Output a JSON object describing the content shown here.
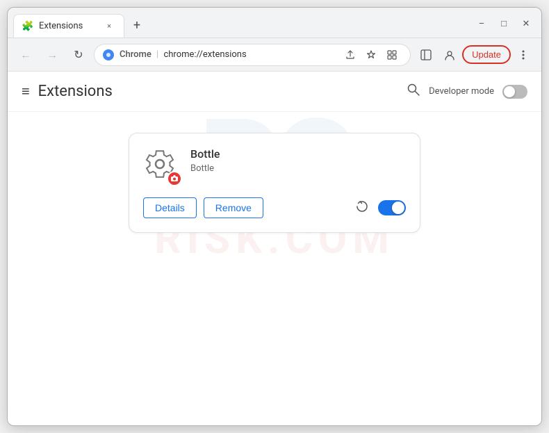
{
  "browser": {
    "tab": {
      "favicon": "🧩",
      "title": "Extensions",
      "close_label": "×"
    },
    "new_tab_label": "+",
    "window_controls": {
      "minimize": "—",
      "maximize": "□",
      "close": "✕"
    },
    "nav": {
      "back": "←",
      "forward": "→",
      "refresh": "↻"
    },
    "url": {
      "site_name": "Chrome",
      "separator": "|",
      "path": "chrome://extensions"
    },
    "toolbar": {
      "share_icon": "⬆",
      "bookmark_icon": "☆",
      "extensions_icon": "🧩",
      "sidebar_icon": "▭",
      "profile_icon": "👤",
      "update_label": "Update",
      "menu_icon": "⋮"
    }
  },
  "page": {
    "title": "Extensions",
    "menu_icon": "≡",
    "search_label": "🔍",
    "developer_mode_label": "Developer mode",
    "developer_mode_on": false
  },
  "extension": {
    "name": "Bottle",
    "description": "Bottle",
    "badge_icon": "📷",
    "badge_text": "▶",
    "details_label": "Details",
    "remove_label": "Remove",
    "refresh_icon": "↻",
    "enabled": true
  },
  "watermark": {
    "pc_text": "PC",
    "risk_text": "RISK.COM"
  }
}
